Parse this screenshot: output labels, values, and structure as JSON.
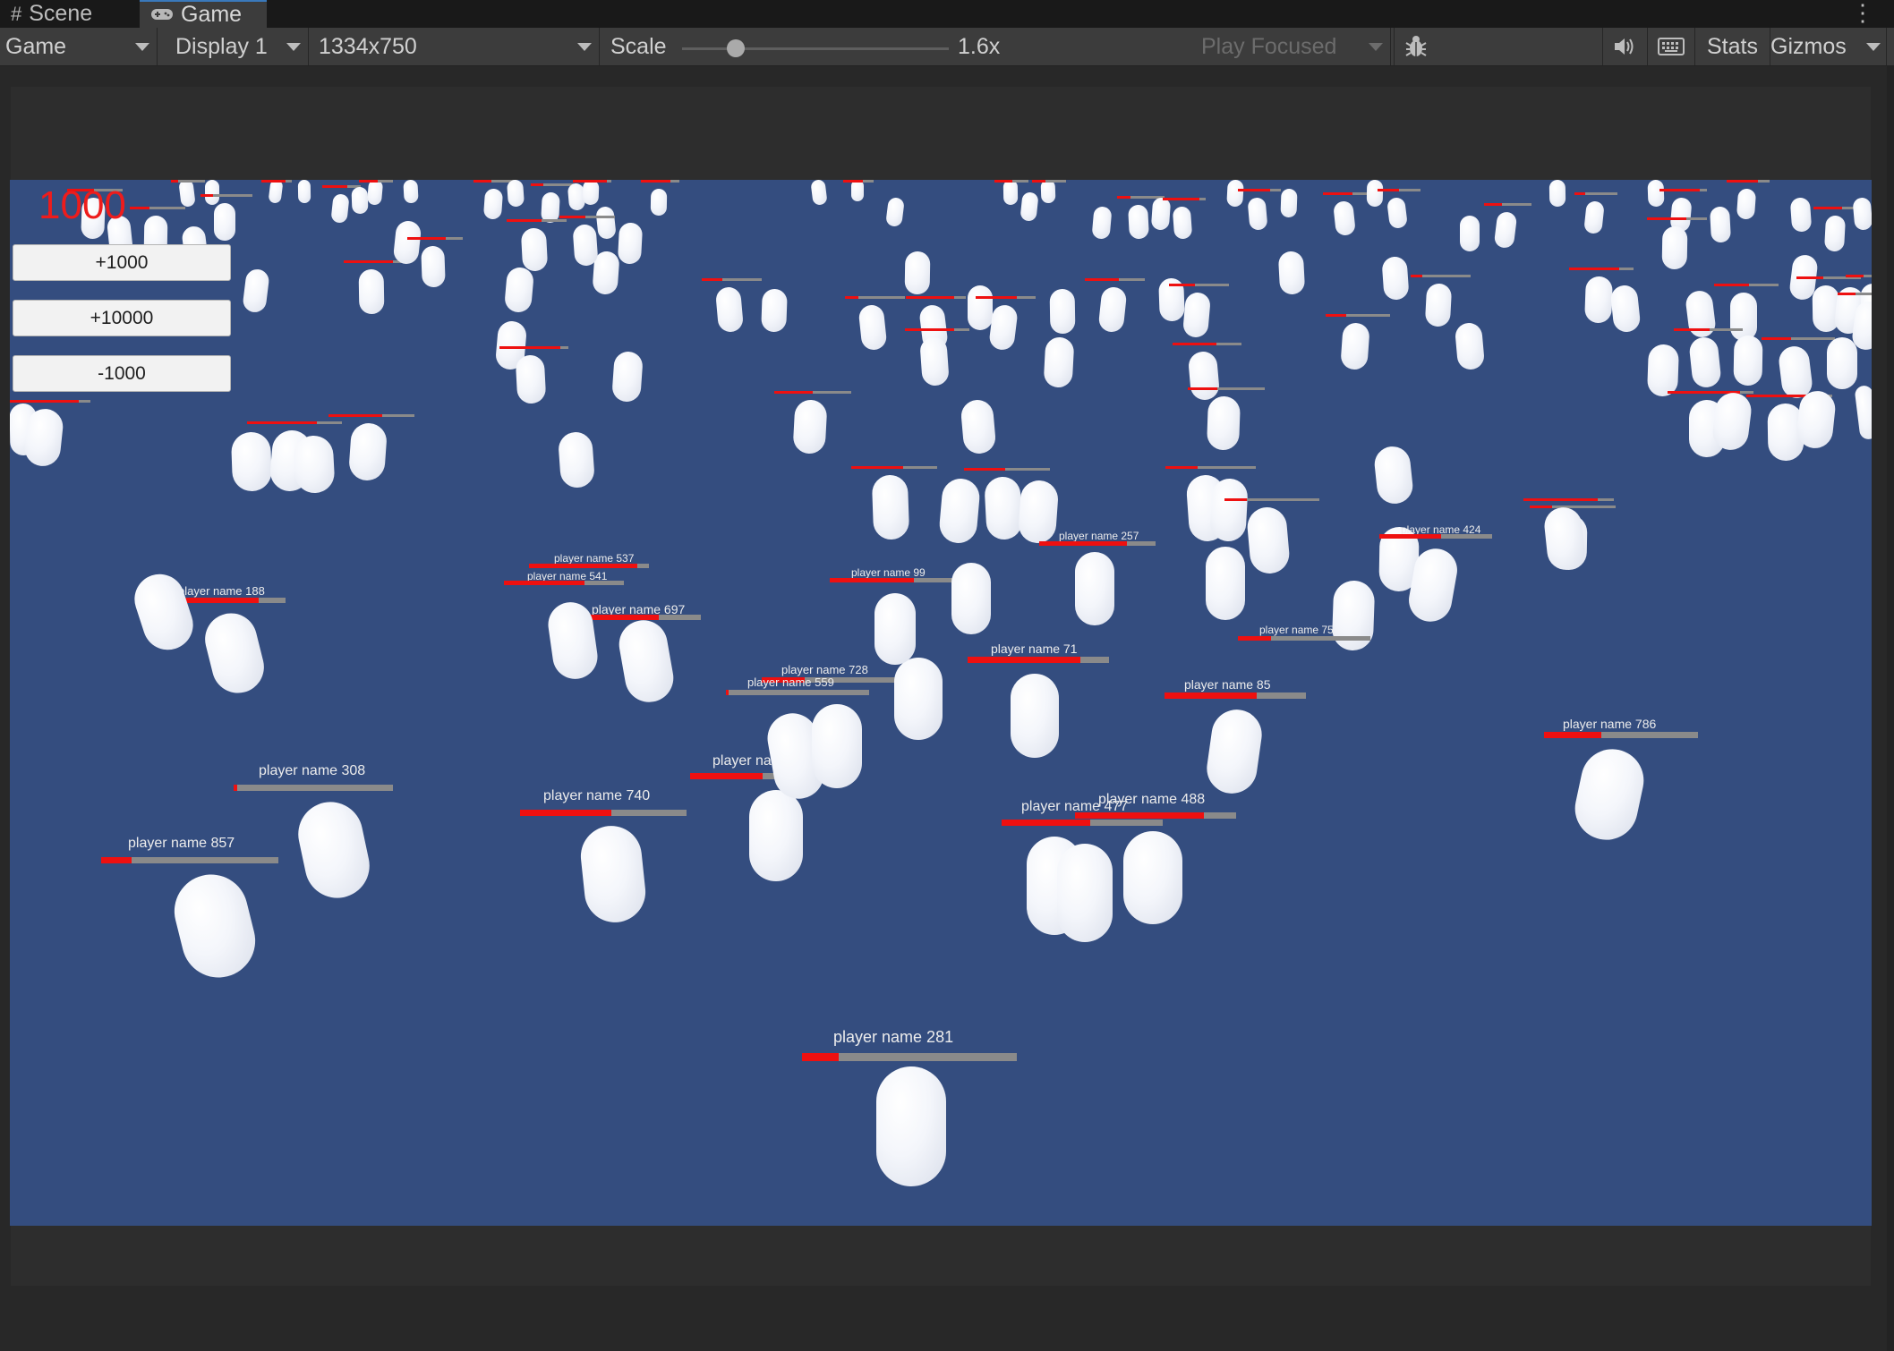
{
  "tabs": {
    "scene": {
      "label": "Scene",
      "icon": "grid-icon"
    },
    "game": {
      "label": "Game",
      "icon": "gamepad-icon"
    }
  },
  "toolbar": {
    "mode": "Game",
    "display": "Display 1",
    "resolution": "1334x750",
    "scale_label": "Scale",
    "scale_value": "1.6x",
    "play_mode": "Play Focused",
    "stats": "Stats",
    "gizmos": "Gizmos",
    "icons": [
      "bug-icon",
      "speaker-icon",
      "keyboard-icon",
      "chevron-down-icon"
    ]
  },
  "game": {
    "score": "1000",
    "buttons": [
      "+1000",
      "+10000",
      "-1000"
    ],
    "players": [
      {
        "name": "player name 281",
        "health": 0.17
      },
      {
        "name": "player name 857",
        "health": 0.17
      },
      {
        "name": "player name 308",
        "health": 0.02
      },
      {
        "name": "player name 740",
        "health": 0.55
      },
      {
        "name": "player name 431",
        "health": 0.45
      },
      {
        "name": "player name 477",
        "health": 0.55
      },
      {
        "name": "player name 488",
        "health": 0.8
      },
      {
        "name": "player name 786",
        "health": 0.37
      },
      {
        "name": "player name 85",
        "health": 0.65
      },
      {
        "name": "player name 71",
        "health": 0.8
      },
      {
        "name": "player name 728",
        "health": 0.3
      },
      {
        "name": "player name 559",
        "health": 0.02
      },
      {
        "name": "player name 697",
        "health": 0.67
      },
      {
        "name": "player name 188",
        "health": 0.8
      },
      {
        "name": "player name 99",
        "health": 0.67
      },
      {
        "name": "player name 257",
        "health": 0.75
      },
      {
        "name": "player name 75",
        "health": 0.25
      },
      {
        "name": "player name 424",
        "health": 0.55
      },
      {
        "name": "player name 537",
        "health": 0.9
      },
      {
        "name": "player name 541",
        "health": 0.67
      }
    ]
  },
  "colors": {
    "sky": "#344d7f",
    "health_fill": "#ee1010",
    "health_bg": "#8a8a8a",
    "score": "#ee1c1c",
    "accent": "#3a79bb"
  }
}
